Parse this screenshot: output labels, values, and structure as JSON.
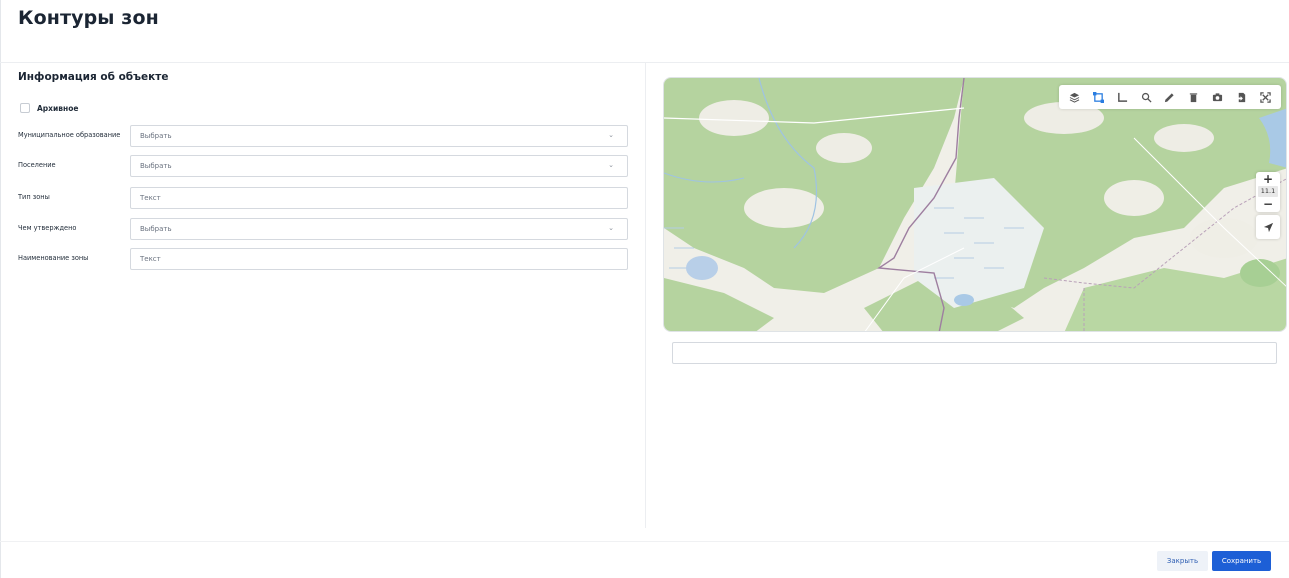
{
  "page": {
    "title": "Контуры зон"
  },
  "form": {
    "section_title": "Информация об объекте",
    "archive_label": "Архивное",
    "archive_checked": false,
    "fields": [
      {
        "label": "Муниципальное образование",
        "value": "Выбрать",
        "type": "select"
      },
      {
        "label": "Поселение",
        "value": "Выбрать",
        "type": "select"
      },
      {
        "label": "Тип зоны",
        "value": "Текст",
        "type": "text"
      },
      {
        "label": "Чем утверждено",
        "value": "Выбрать",
        "type": "select"
      },
      {
        "label": "Наименование зоны",
        "value": "Текст",
        "type": "text"
      }
    ]
  },
  "map": {
    "zoom_level": "11.1",
    "toolbar_icons": [
      "layers-icon",
      "select-area-icon",
      "measure-icon",
      "search-icon",
      "edit-icon",
      "delete-icon",
      "camera-icon",
      "import-icon",
      "fullscreen-icon"
    ],
    "colors": {
      "forest": "#b5d39f",
      "land": "#f0efe8",
      "water": "#a9c9e6",
      "boundary": "#9e7fa0"
    }
  },
  "coordinates_input": {
    "value": ""
  },
  "footer": {
    "close_label": "Закрыть",
    "save_label": "Сохранить"
  },
  "colors": {
    "primary": "#1d5fd6",
    "active_tool": "#2a7de1"
  }
}
